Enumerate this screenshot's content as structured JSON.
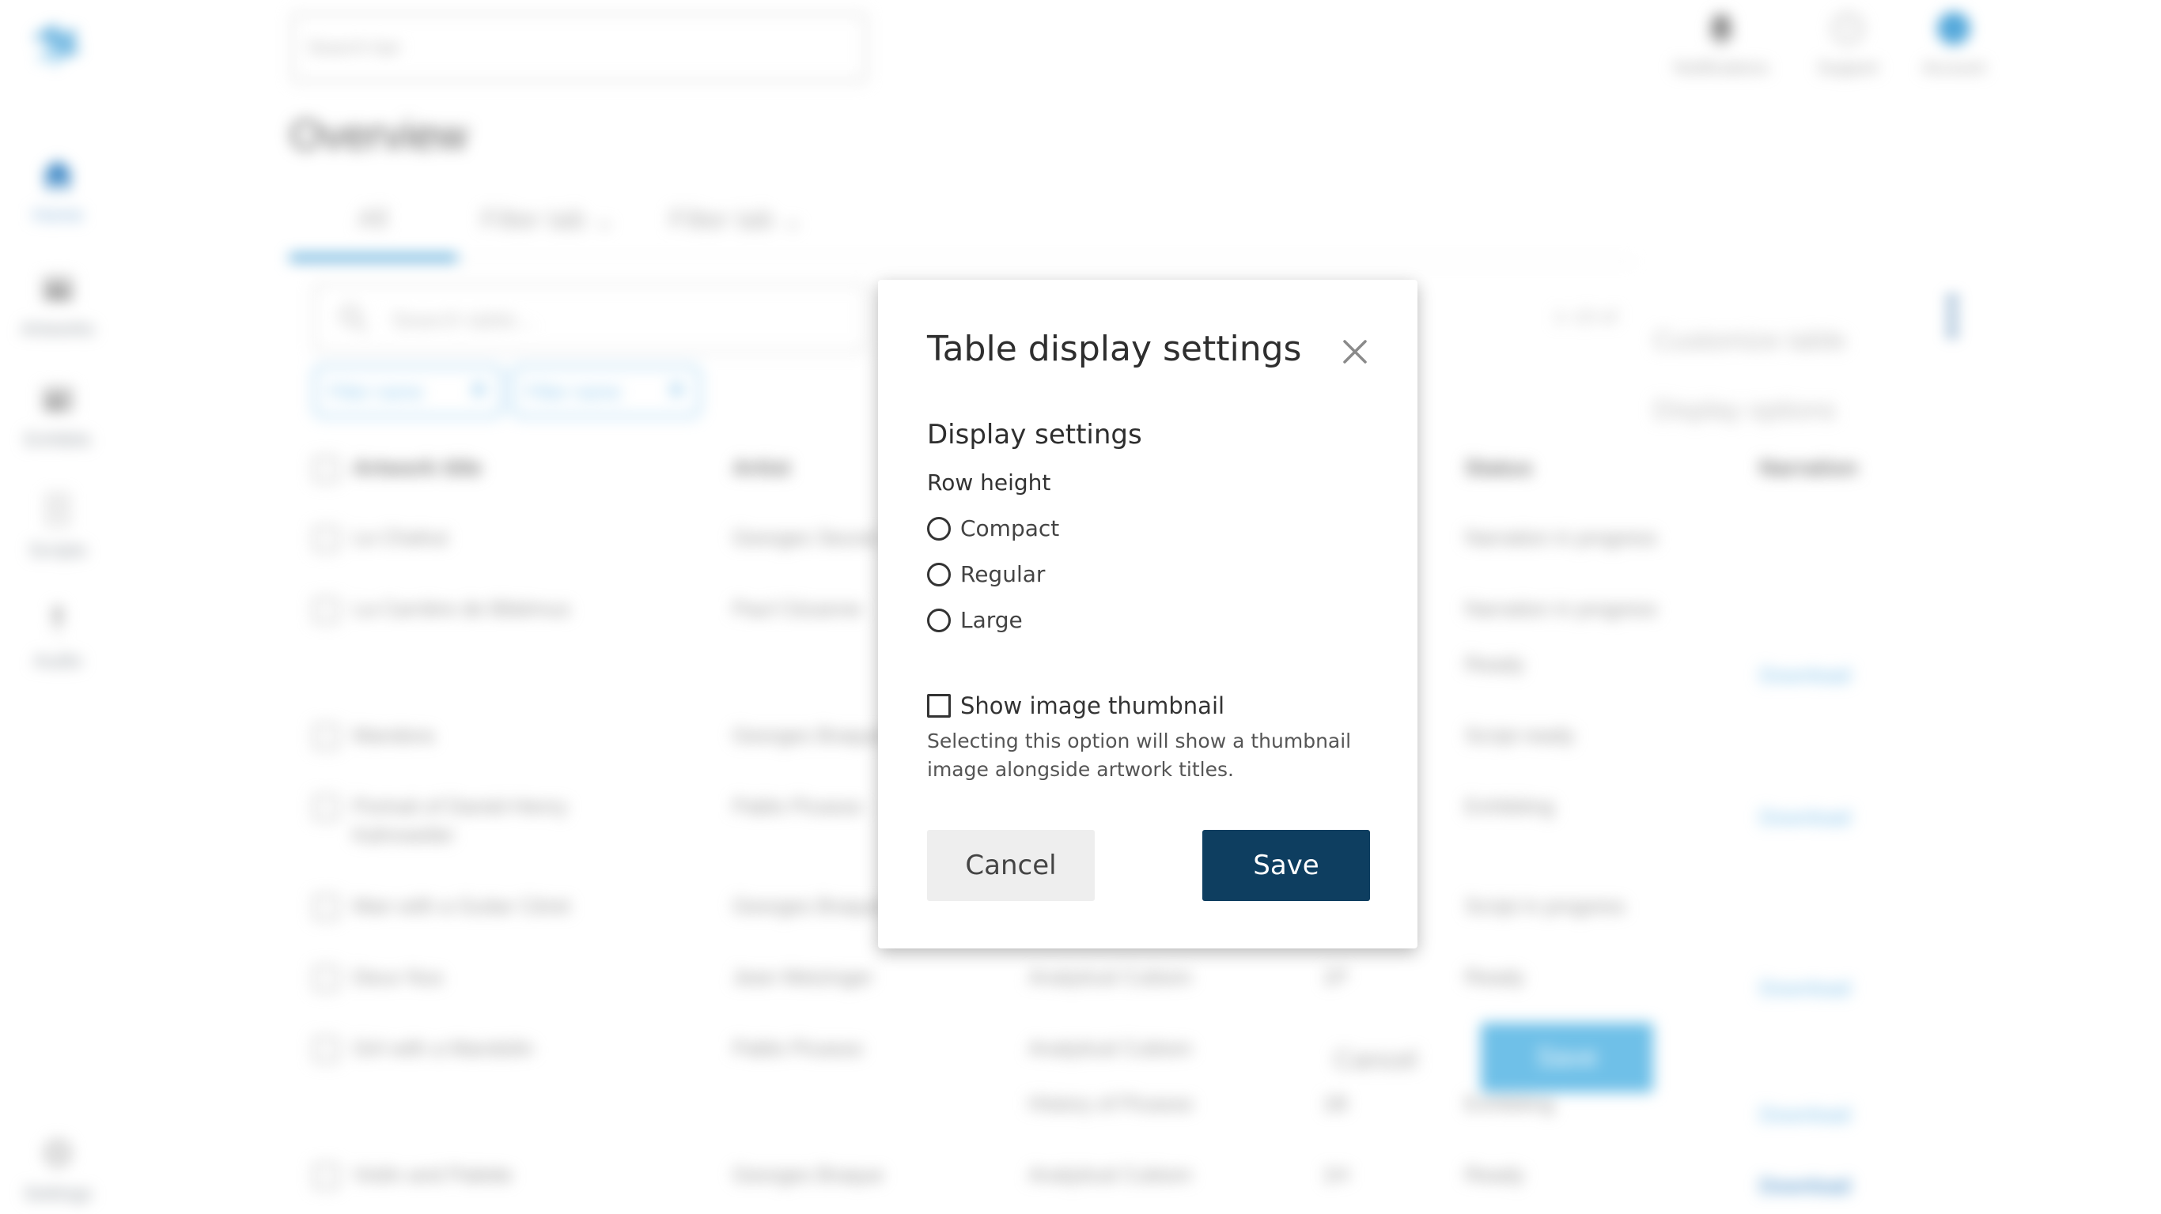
{
  "background": {
    "search_placeholder": "Search bar",
    "page_title": "Overview",
    "sidebar": [
      {
        "label": "Home"
      },
      {
        "label": "Artworks"
      },
      {
        "label": "Exhibits"
      },
      {
        "label": "Scripts"
      },
      {
        "label": "Audio"
      },
      {
        "label": "Settings"
      }
    ],
    "header_actions": [
      {
        "label": "Notifications",
        "icon": "bell-icon"
      },
      {
        "label": "Support",
        "icon": "help-icon"
      },
      {
        "label": "Account",
        "icon": "account-icon",
        "initials": "SB"
      }
    ],
    "tabs": [
      "All",
      "Filter tab",
      "Filter tab"
    ],
    "table_search_placeholder": "Search table...",
    "filter_chips": [
      "Filter name",
      "Filter name"
    ],
    "pagination": "1–10 of",
    "customize_table": "Customize table",
    "display_options": "Display options",
    "columns": [
      "Artwork title",
      "Artist",
      "Status",
      "Narration"
    ],
    "rows": [
      {
        "title": "Le Chahut",
        "artist": "Georges Seurat",
        "style": "",
        "num": "",
        "status": "Narration in progress",
        "narration": ""
      },
      {
        "title": "La Carrière de Bibémus",
        "artist": "Paul Cézanne",
        "style": "",
        "num": "",
        "status": "Narration in progress",
        "narration": ""
      },
      {
        "title": "",
        "artist": "",
        "style": "",
        "num": "",
        "status": "Ready",
        "narration": "Download"
      },
      {
        "title": "Mandora",
        "artist": "Georges Braque",
        "style": "",
        "num": "",
        "status": "Script ready",
        "narration": ""
      },
      {
        "title": "Portrait of Daniel-Henry Kahnweiler",
        "artist": "Pablo Picasso",
        "style": "",
        "num": "",
        "status": "Exhibiting",
        "narration": "Download"
      },
      {
        "title": "Man with a Guitar Céret",
        "artist": "Georges Braque",
        "style": "",
        "num": "",
        "status": "Script in progress",
        "narration": ""
      },
      {
        "title": "Deux Nus",
        "artist": "Jean Metzinger",
        "style": "Analytical Cubism",
        "num": "1P",
        "status": "Ready",
        "narration": "Download"
      },
      {
        "title": "Girl with a Mandolin",
        "artist": "Pablo Picasso",
        "style": "Analytical Cubism",
        "num": "",
        "status": "",
        "narration": ""
      },
      {
        "title": "",
        "artist": "",
        "style": "History of Picasso",
        "num": "1B",
        "status": "Exhibiting",
        "narration": "Download"
      },
      {
        "title": "Violin and Palette",
        "artist": "Georges Braque",
        "style": "Analytical Cubism",
        "num": "1H",
        "status": "Ready",
        "narration": "Download"
      }
    ],
    "ghost_cancel": "Cancel",
    "ghost_save": "Save"
  },
  "modal": {
    "title": "Table display settings",
    "section_title": "Display settings",
    "row_height_label": "Row height",
    "row_height_options": [
      "Compact",
      "Regular",
      "Large"
    ],
    "thumbnail_label": "Show image thumbnail",
    "thumbnail_help": "Selecting this option will show a thumbnail image alongside artwork titles.",
    "cancel_label": "Cancel",
    "save_label": "Save"
  },
  "colors": {
    "accent": "#3a9bd5",
    "primary_button": "#0e3e60",
    "secondary_button": "#eeeeee"
  }
}
